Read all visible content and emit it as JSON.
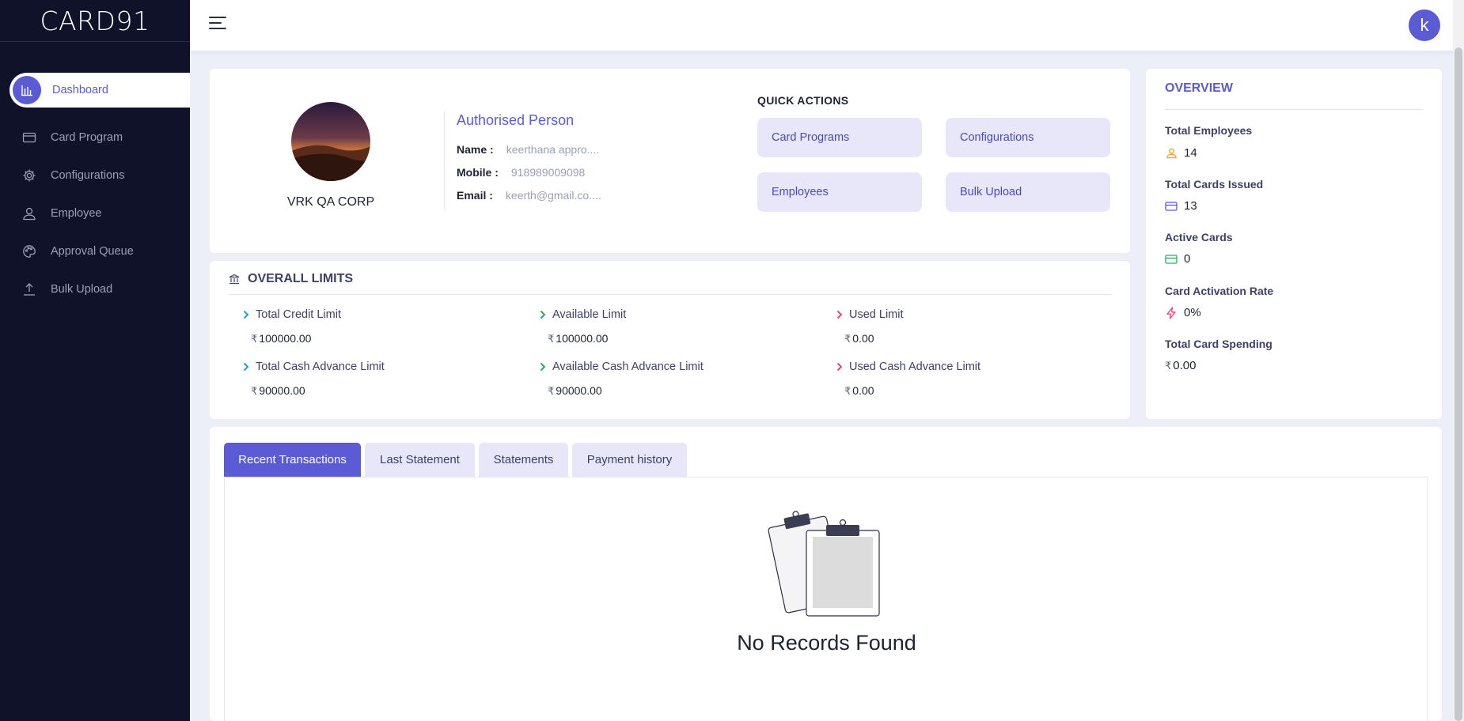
{
  "app": {
    "logo": "CARD91"
  },
  "sidebar": {
    "items": [
      {
        "label": "Dashboard",
        "icon": "bar-chart-icon",
        "active": true
      },
      {
        "label": "Card Program",
        "icon": "credit-card-icon"
      },
      {
        "label": "Configurations",
        "icon": "gear-icon"
      },
      {
        "label": "Employee",
        "icon": "user-icon"
      },
      {
        "label": "Approval Queue",
        "icon": "palette-icon"
      },
      {
        "label": "Bulk Upload",
        "icon": "upload-icon"
      }
    ]
  },
  "header": {
    "avatar_letter": "k"
  },
  "profile": {
    "company": "VRK QA CORP",
    "auth_title": "Authorised Person",
    "name_label": "Name :",
    "name_value": "keerthana appro....",
    "mobile_label": "Mobile :",
    "mobile_value": "918989009098",
    "email_label": "Email :",
    "email_value": "keerth@gmail.co...."
  },
  "quick_actions": {
    "title": "QUICK ACTIONS",
    "buttons": [
      "Card Programs",
      "Configurations",
      "Employees",
      "Bulk Upload"
    ]
  },
  "overview": {
    "title": "OVERVIEW",
    "items": [
      {
        "label": "Total Employees",
        "value": "14",
        "icon": "user-icon"
      },
      {
        "label": "Total Cards Issued",
        "value": "13",
        "icon": "credit-card-icon"
      },
      {
        "label": "Active Cards",
        "value": "0",
        "icon": "credit-card-icon"
      },
      {
        "label": "Card Activation Rate",
        "value": "0%",
        "icon": "lightning-icon"
      },
      {
        "label": "Total Card Spending",
        "value": "0.00",
        "icon": "rupee-icon"
      }
    ]
  },
  "limits": {
    "title": "OVERALL LIMITS",
    "currency": "₹",
    "items": [
      {
        "label": "Total Credit Limit",
        "value": "100000.00"
      },
      {
        "label": "Available Limit",
        "value": "100000.00"
      },
      {
        "label": "Used Limit",
        "value": "0.00"
      },
      {
        "label": "Total Cash Advance Limit",
        "value": "90000.00"
      },
      {
        "label": "Available Cash Advance Limit",
        "value": "90000.00"
      },
      {
        "label": "Used Cash Advance Limit",
        "value": "0.00"
      }
    ]
  },
  "tabs": {
    "items": [
      "Recent Transactions",
      "Last Statement",
      "Statements",
      "Payment history"
    ],
    "active": "Recent Transactions",
    "empty_text": "No Records Found"
  },
  "colors": {
    "accent": "#5b5bd6",
    "sidebar": "#0f1229",
    "tab_bg": "#e8e7fa"
  }
}
